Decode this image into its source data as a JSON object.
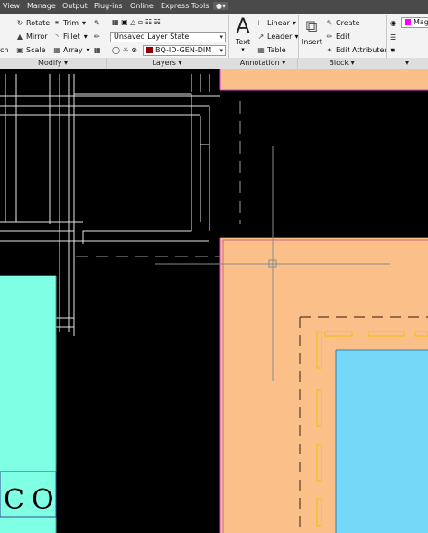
{
  "menu": [
    {
      "label": "View"
    },
    {
      "label": "Manage"
    },
    {
      "label": "Output"
    },
    {
      "label": "Plug-ins"
    },
    {
      "label": "Online"
    },
    {
      "label": "Express Tools"
    }
  ],
  "modify": {
    "title": "Modify",
    "rotate": "Rotate",
    "trim": "Trim",
    "mirror": "Mirror",
    "fillet": "Fillet",
    "stretch_partial": "ch",
    "scale": "Scale",
    "array": "Array"
  },
  "layers": {
    "title": "Layers",
    "layer_state": "Unsaved Layer State",
    "current_layer": "BQ-ID-GEN-DIM",
    "layer_color": "#8b0000"
  },
  "annotation": {
    "title": "Annotation",
    "text": "Text",
    "linear": "Linear",
    "leader": "Leader",
    "table": "Table"
  },
  "block": {
    "title": "Block",
    "insert": "Insert",
    "create": "Create",
    "edit": "Edit",
    "edit_attributes": "Edit Attributes"
  },
  "properties": {
    "color_label": "Mag",
    "color": "#ff00ff"
  },
  "canvas": {
    "background": "#000000",
    "hatch_orange": "#fbc08a",
    "hatch_cyan": "#7fffe4",
    "hatch_blue": "#76d8f8",
    "partial_text": "CO"
  }
}
